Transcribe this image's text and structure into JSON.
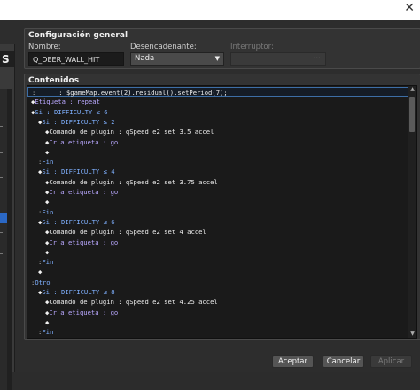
{
  "window": {
    "close_glyph": "✕"
  },
  "left_panel": {
    "heading_fragment": "S"
  },
  "general": {
    "title": "Configuración general",
    "name_label": "Nombre:",
    "name_value": "Q_DEER_WALL_HIT",
    "trigger_label": "Desencadenante:",
    "trigger_value": "Nada",
    "switch_label": "Interruptor:",
    "switch_button": "..."
  },
  "contents": {
    "title": "Contenidos",
    "lines": [
      {
        "indent": 0,
        "marker": ":",
        "parts": [
          {
            "text": "      : $gameMap.event(2).residual().setPeriod(7);",
            "color": "white"
          }
        ],
        "selected": true
      },
      {
        "indent": 0,
        "marker": "◆",
        "parts": [
          {
            "text": "Etiqueta : repeat",
            "color": "lav"
          }
        ]
      },
      {
        "indent": 0,
        "marker": "◆",
        "parts": [
          {
            "text": "Si : DIFFICULTY ≤ 6",
            "color": "blue"
          }
        ]
      },
      {
        "indent": 1,
        "marker": "◆",
        "parts": [
          {
            "text": "Si : DIFFICULTY ≤ 2",
            "color": "blue"
          }
        ]
      },
      {
        "indent": 2,
        "marker": "◆",
        "parts": [
          {
            "text": "Comando de plugin : ",
            "color": "white"
          },
          {
            "text": "qSpeed e2 set 3.5 accel",
            "color": "white"
          }
        ]
      },
      {
        "indent": 2,
        "marker": "◆",
        "parts": [
          {
            "text": "Ir a etiqueta : go",
            "color": "lav"
          }
        ]
      },
      {
        "indent": 2,
        "marker": "◆",
        "parts": []
      },
      {
        "indent": 1,
        "marker": ":",
        "parts": [
          {
            "text": "Fin",
            "color": "blue"
          }
        ]
      },
      {
        "indent": 1,
        "marker": "◆",
        "parts": [
          {
            "text": "Si : DIFFICULTY ≤ 4",
            "color": "blue"
          }
        ]
      },
      {
        "indent": 2,
        "marker": "◆",
        "parts": [
          {
            "text": "Comando de plugin : ",
            "color": "white"
          },
          {
            "text": "qSpeed e2 set 3.75 accel",
            "color": "white"
          }
        ]
      },
      {
        "indent": 2,
        "marker": "◆",
        "parts": [
          {
            "text": "Ir a etiqueta : go",
            "color": "lav"
          }
        ]
      },
      {
        "indent": 2,
        "marker": "◆",
        "parts": []
      },
      {
        "indent": 1,
        "marker": ":",
        "parts": [
          {
            "text": "Fin",
            "color": "blue"
          }
        ]
      },
      {
        "indent": 1,
        "marker": "◆",
        "parts": [
          {
            "text": "Si : DIFFICULTY ≤ 6",
            "color": "blue"
          }
        ]
      },
      {
        "indent": 2,
        "marker": "◆",
        "parts": [
          {
            "text": "Comando de plugin : ",
            "color": "white"
          },
          {
            "text": "qSpeed e2 set 4 accel",
            "color": "white"
          }
        ]
      },
      {
        "indent": 2,
        "marker": "◆",
        "parts": [
          {
            "text": "Ir a etiqueta : go",
            "color": "lav"
          }
        ]
      },
      {
        "indent": 2,
        "marker": "◆",
        "parts": []
      },
      {
        "indent": 1,
        "marker": ":",
        "parts": [
          {
            "text": "Fin",
            "color": "blue"
          }
        ]
      },
      {
        "indent": 1,
        "marker": "◆",
        "parts": []
      },
      {
        "indent": 0,
        "marker": ":",
        "parts": [
          {
            "text": "Otro",
            "color": "blue"
          }
        ]
      },
      {
        "indent": 1,
        "marker": "◆",
        "parts": [
          {
            "text": "Si : DIFFICULTY ≤ 8",
            "color": "blue"
          }
        ]
      },
      {
        "indent": 2,
        "marker": "◆",
        "parts": [
          {
            "text": "Comando de plugin : ",
            "color": "white"
          },
          {
            "text": "qSpeed e2 set 4.25 accel",
            "color": "white"
          }
        ]
      },
      {
        "indent": 2,
        "marker": "◆",
        "parts": [
          {
            "text": "Ir a etiqueta : go",
            "color": "lav"
          }
        ]
      },
      {
        "indent": 2,
        "marker": "◆",
        "parts": []
      },
      {
        "indent": 1,
        "marker": ":",
        "parts": [
          {
            "text": "Fin",
            "color": "blue"
          }
        ]
      }
    ]
  },
  "buttons": {
    "accept": "Aceptar",
    "cancel": "Cancelar",
    "apply": "Aplicar"
  },
  "colors": {
    "blue": "#7fb0ff",
    "lav": "#b9a8ff",
    "white": "#ececec",
    "selection_border": "#3d6ea6"
  }
}
